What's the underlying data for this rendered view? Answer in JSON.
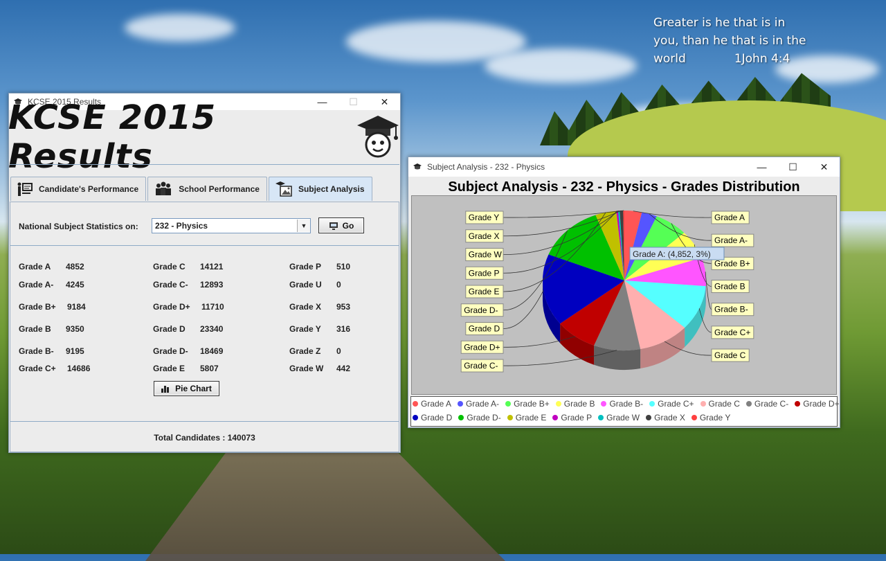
{
  "desktop": {
    "verse_lines": [
      "Greater is he that is in",
      "you, than he that is in the",
      "world"
    ],
    "verse_ref": "1John 4:4"
  },
  "main_window": {
    "title": "KCSE 2015 Results",
    "banner_title": "KCSE 2015 Results",
    "tabs": [
      {
        "label": "Candidate's Performance",
        "icon": "teacher-icon",
        "active": false
      },
      {
        "label": "School Performance",
        "icon": "group-icon",
        "active": false
      },
      {
        "label": "Subject Analysis",
        "icon": "graduate-image-icon",
        "active": true
      }
    ],
    "national_label": "National Subject Statistics on:",
    "subject_select_value": "232 - Physics",
    "go_label": "Go",
    "pie_chart_label": "Pie Chart",
    "grades_col1": [
      {
        "label": "Grade A",
        "value": "4852"
      },
      {
        "label": "Grade A-",
        "value": "4245"
      },
      {
        "label": "Grade B+",
        "value": "9184"
      },
      {
        "label": "Grade B",
        "value": "9350"
      },
      {
        "label": "Grade B-",
        "value": "9195"
      },
      {
        "label": "Grade C+",
        "value": "14686"
      }
    ],
    "grades_col2": [
      {
        "label": "Grade C",
        "value": "14121"
      },
      {
        "label": "Grade C-",
        "value": "12893"
      },
      {
        "label": "Grade D+",
        "value": "11710"
      },
      {
        "label": "Grade D",
        "value": "23340"
      },
      {
        "label": "Grade D-",
        "value": "18469"
      },
      {
        "label": "Grade E",
        "value": "5807"
      }
    ],
    "grades_col3": [
      {
        "label": "Grade P",
        "value": "510"
      },
      {
        "label": "Grade U",
        "value": "0"
      },
      {
        "label": "Grade X",
        "value": "953"
      },
      {
        "label": "Grade Y",
        "value": "316"
      },
      {
        "label": "Grade Z",
        "value": "0"
      },
      {
        "label": "Grade W",
        "value": "442"
      }
    ],
    "total_label": "Total Candidates :",
    "total_value": "140073"
  },
  "chart_window": {
    "title": "Subject Analysis - 232 - Physics",
    "tooltip": "Grade A: (4,852, 3%)"
  },
  "chart_data": {
    "type": "pie",
    "title": "Subject Analysis - 232 - Physics - Grades Distribution",
    "slices": [
      {
        "label": "Grade A",
        "value": 4852,
        "color": "#ff5555"
      },
      {
        "label": "Grade A-",
        "value": 4245,
        "color": "#5555ff"
      },
      {
        "label": "Grade B+",
        "value": 9184,
        "color": "#55ff55"
      },
      {
        "label": "Grade B",
        "value": 9350,
        "color": "#ffff55"
      },
      {
        "label": "Grade B-",
        "value": 9195,
        "color": "#ff55ff"
      },
      {
        "label": "Grade C+",
        "value": 14686,
        "color": "#55ffff"
      },
      {
        "label": "Grade C",
        "value": 14121,
        "color": "#ffafaf"
      },
      {
        "label": "Grade C-",
        "value": 12893,
        "color": "#808080"
      },
      {
        "label": "Grade D+",
        "value": 11710,
        "color": "#c00000"
      },
      {
        "label": "Grade D",
        "value": 23340,
        "color": "#0000c0"
      },
      {
        "label": "Grade D-",
        "value": 18469,
        "color": "#00c000"
      },
      {
        "label": "Grade E",
        "value": 5807,
        "color": "#c0c000"
      },
      {
        "label": "Grade P",
        "value": 510,
        "color": "#c000c0"
      },
      {
        "label": "Grade W",
        "value": 442,
        "color": "#00c0c0"
      },
      {
        "label": "Grade X",
        "value": 953,
        "color": "#404040"
      },
      {
        "label": "Grade Y",
        "value": 316,
        "color": "#ff4040"
      }
    ],
    "legend_placement": "bottom"
  }
}
